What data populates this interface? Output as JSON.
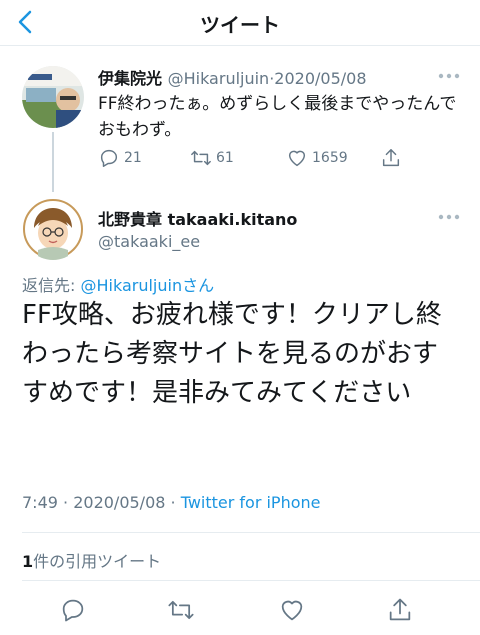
{
  "nav": {
    "title": "ツイート"
  },
  "parent": {
    "display_name": "伊集院光",
    "handle": "@Hikaruljuin",
    "sep": "·",
    "date": "2020/05/08",
    "text": "FF終わったぁ。めずらしく最後までやったんでおもわず。",
    "reply_count": "21",
    "retweet_count": "61",
    "like_count": "1659"
  },
  "tweet": {
    "display_name": "北野貴章 takaaki.kitano",
    "handle": "@takaaki_ee",
    "reply_label": "返信先: ",
    "reply_handle": "@Hikaruljuin",
    "reply_suffix": "さん",
    "text": "FF攻略、お疲れ様です！クリアし終わったら考察サイトを見るのがおすすめです！是非みてみてください",
    "time": "7:49",
    "sep": " · ",
    "date": "2020/05/08",
    "sep2": " · ",
    "client": "Twitter for iPhone",
    "quote_count": "1",
    "quote_label": "件の引用ツイート"
  },
  "colors": {
    "accent": "#1b95e0",
    "muted": "#657786",
    "text": "#14171a",
    "border": "#e6ecf0"
  },
  "icons": [
    "back-chevron-icon",
    "more-icon",
    "reply-icon",
    "retweet-icon",
    "like-icon",
    "share-icon"
  ]
}
